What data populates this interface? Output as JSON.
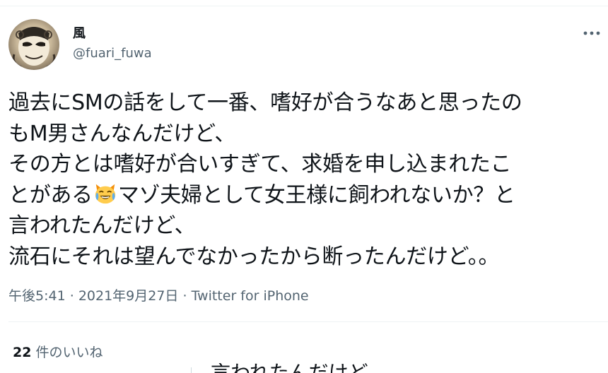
{
  "user": {
    "display_name": "風",
    "handle": "@fuari_fuwa"
  },
  "tweet": {
    "lines": [
      "過去にSMの話をして一番、嗜好が合うなあと思ったの",
      "もM男さんなんだけど、",
      "その方とは嗜好が合いすぎて、求婚を申し込まれたこ",
      "とがある",
      "マゾ夫婦として女王様に飼われないか？と",
      "言われたんだけど、",
      "流石にそれは望んでなかったから断ったんだけど。。"
    ],
    "emoji": "laughing-crying-cat-face"
  },
  "meta": {
    "time": "午後5:41",
    "separator": "·",
    "date": "2021年9月27日",
    "source": "Twitter for iPhone"
  },
  "engagement": {
    "likes_count": "22",
    "likes_label": "件のいいね"
  },
  "next_tweet_fragment": "言われたんだけど"
}
